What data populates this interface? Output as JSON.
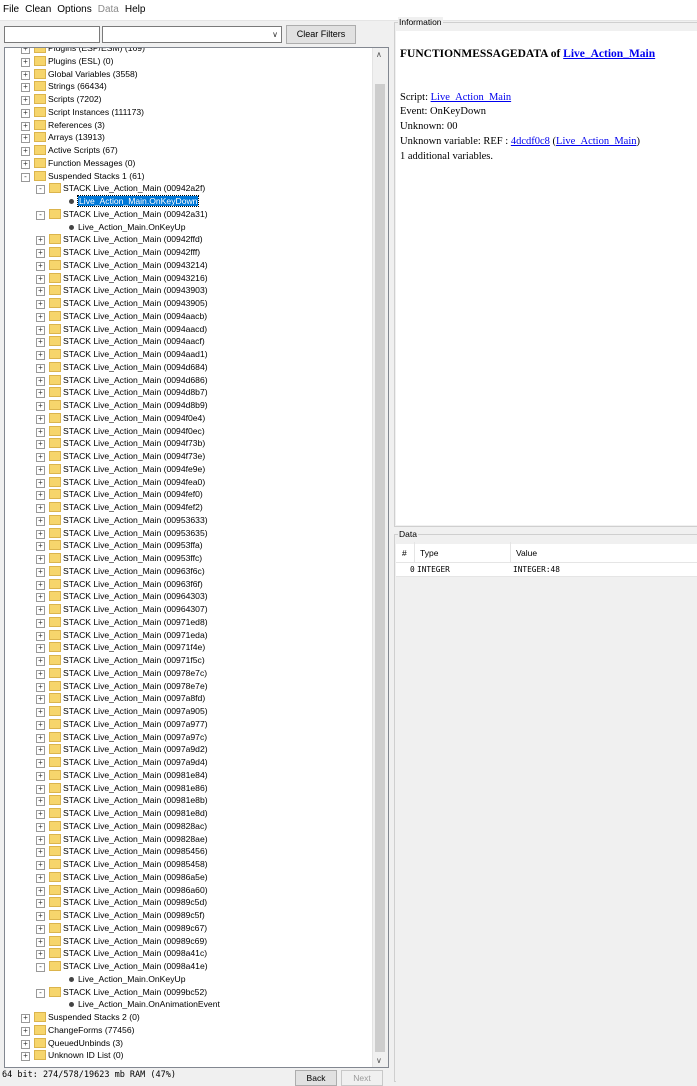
{
  "menu": {
    "file": "File",
    "clean": "Clean",
    "options": "Options",
    "data": "Data",
    "help": "Help"
  },
  "filters": {
    "text_value": "",
    "combo_value": "",
    "clear_button": "Clear Filters"
  },
  "tree": [
    {
      "level": 1,
      "expander": "+",
      "folder": true,
      "label": "Plugins (ESP/ESM) (169)"
    },
    {
      "level": 1,
      "expander": "+",
      "folder": true,
      "label": "Plugins (ESL) (0)"
    },
    {
      "level": 1,
      "expander": "+",
      "folder": true,
      "label": "Global Variables (3558)"
    },
    {
      "level": 1,
      "expander": "+",
      "folder": true,
      "label": "Strings (66434)"
    },
    {
      "level": 1,
      "expander": "+",
      "folder": true,
      "label": "Scripts (7202)"
    },
    {
      "level": 1,
      "expander": "+",
      "folder": true,
      "label": "Script Instances (111173)"
    },
    {
      "level": 1,
      "expander": "+",
      "folder": true,
      "label": "References (3)"
    },
    {
      "level": 1,
      "expander": "+",
      "folder": true,
      "label": "Arrays (13913)"
    },
    {
      "level": 1,
      "expander": "+",
      "folder": true,
      "label": "Active Scripts (67)"
    },
    {
      "level": 1,
      "expander": "+",
      "folder": true,
      "label": "Function Messages (0)"
    },
    {
      "level": 1,
      "expander": "-",
      "folder": true,
      "label": "Suspended Stacks 1 (61)"
    },
    {
      "level": 2,
      "expander": "-",
      "folder": true,
      "label": "STACK Live_Action_Main (00942a2f)"
    },
    {
      "level": 3,
      "expander": "",
      "folder": false,
      "label": "Live_Action_Main.OnKeyDown",
      "selected": true
    },
    {
      "level": 2,
      "expander": "-",
      "folder": true,
      "label": "STACK Live_Action_Main (00942a31)"
    },
    {
      "level": 3,
      "expander": "",
      "folder": false,
      "label": "Live_Action_Main.OnKeyUp"
    },
    {
      "level": 2,
      "expander": "+",
      "folder": true,
      "label": "STACK Live_Action_Main (00942ffd)"
    },
    {
      "level": 2,
      "expander": "+",
      "folder": true,
      "label": "STACK Live_Action_Main (00942fff)"
    },
    {
      "level": 2,
      "expander": "+",
      "folder": true,
      "label": "STACK Live_Action_Main (00943214)"
    },
    {
      "level": 2,
      "expander": "+",
      "folder": true,
      "label": "STACK Live_Action_Main (00943216)"
    },
    {
      "level": 2,
      "expander": "+",
      "folder": true,
      "label": "STACK Live_Action_Main (00943903)"
    },
    {
      "level": 2,
      "expander": "+",
      "folder": true,
      "label": "STACK Live_Action_Main (00943905)"
    },
    {
      "level": 2,
      "expander": "+",
      "folder": true,
      "label": "STACK Live_Action_Main (0094aacb)"
    },
    {
      "level": 2,
      "expander": "+",
      "folder": true,
      "label": "STACK Live_Action_Main (0094aacd)"
    },
    {
      "level": 2,
      "expander": "+",
      "folder": true,
      "label": "STACK Live_Action_Main (0094aacf)"
    },
    {
      "level": 2,
      "expander": "+",
      "folder": true,
      "label": "STACK Live_Action_Main (0094aad1)"
    },
    {
      "level": 2,
      "expander": "+",
      "folder": true,
      "label": "STACK Live_Action_Main (0094d684)"
    },
    {
      "level": 2,
      "expander": "+",
      "folder": true,
      "label": "STACK Live_Action_Main (0094d686)"
    },
    {
      "level": 2,
      "expander": "+",
      "folder": true,
      "label": "STACK Live_Action_Main (0094d8b7)"
    },
    {
      "level": 2,
      "expander": "+",
      "folder": true,
      "label": "STACK Live_Action_Main (0094d8b9)"
    },
    {
      "level": 2,
      "expander": "+",
      "folder": true,
      "label": "STACK Live_Action_Main (0094f0e4)"
    },
    {
      "level": 2,
      "expander": "+",
      "folder": true,
      "label": "STACK Live_Action_Main (0094f0ec)"
    },
    {
      "level": 2,
      "expander": "+",
      "folder": true,
      "label": "STACK Live_Action_Main (0094f73b)"
    },
    {
      "level": 2,
      "expander": "+",
      "folder": true,
      "label": "STACK Live_Action_Main (0094f73e)"
    },
    {
      "level": 2,
      "expander": "+",
      "folder": true,
      "label": "STACK Live_Action_Main (0094fe9e)"
    },
    {
      "level": 2,
      "expander": "+",
      "folder": true,
      "label": "STACK Live_Action_Main (0094fea0)"
    },
    {
      "level": 2,
      "expander": "+",
      "folder": true,
      "label": "STACK Live_Action_Main (0094fef0)"
    },
    {
      "level": 2,
      "expander": "+",
      "folder": true,
      "label": "STACK Live_Action_Main (0094fef2)"
    },
    {
      "level": 2,
      "expander": "+",
      "folder": true,
      "label": "STACK Live_Action_Main (00953633)"
    },
    {
      "level": 2,
      "expander": "+",
      "folder": true,
      "label": "STACK Live_Action_Main (00953635)"
    },
    {
      "level": 2,
      "expander": "+",
      "folder": true,
      "label": "STACK Live_Action_Main (00953ffa)"
    },
    {
      "level": 2,
      "expander": "+",
      "folder": true,
      "label": "STACK Live_Action_Main (00953ffc)"
    },
    {
      "level": 2,
      "expander": "+",
      "folder": true,
      "label": "STACK Live_Action_Main (00963f6c)"
    },
    {
      "level": 2,
      "expander": "+",
      "folder": true,
      "label": "STACK Live_Action_Main (00963f6f)"
    },
    {
      "level": 2,
      "expander": "+",
      "folder": true,
      "label": "STACK Live_Action_Main (00964303)"
    },
    {
      "level": 2,
      "expander": "+",
      "folder": true,
      "label": "STACK Live_Action_Main (00964307)"
    },
    {
      "level": 2,
      "expander": "+",
      "folder": true,
      "label": "STACK Live_Action_Main (00971ed8)"
    },
    {
      "level": 2,
      "expander": "+",
      "folder": true,
      "label": "STACK Live_Action_Main (00971eda)"
    },
    {
      "level": 2,
      "expander": "+",
      "folder": true,
      "label": "STACK Live_Action_Main (00971f4e)"
    },
    {
      "level": 2,
      "expander": "+",
      "folder": true,
      "label": "STACK Live_Action_Main (00971f5c)"
    },
    {
      "level": 2,
      "expander": "+",
      "folder": true,
      "label": "STACK Live_Action_Main (00978e7c)"
    },
    {
      "level": 2,
      "expander": "+",
      "folder": true,
      "label": "STACK Live_Action_Main (00978e7e)"
    },
    {
      "level": 2,
      "expander": "+",
      "folder": true,
      "label": "STACK Live_Action_Main (0097a8fd)"
    },
    {
      "level": 2,
      "expander": "+",
      "folder": true,
      "label": "STACK Live_Action_Main (0097a905)"
    },
    {
      "level": 2,
      "expander": "+",
      "folder": true,
      "label": "STACK Live_Action_Main (0097a977)"
    },
    {
      "level": 2,
      "expander": "+",
      "folder": true,
      "label": "STACK Live_Action_Main (0097a97c)"
    },
    {
      "level": 2,
      "expander": "+",
      "folder": true,
      "label": "STACK Live_Action_Main (0097a9d2)"
    },
    {
      "level": 2,
      "expander": "+",
      "folder": true,
      "label": "STACK Live_Action_Main (0097a9d4)"
    },
    {
      "level": 2,
      "expander": "+",
      "folder": true,
      "label": "STACK Live_Action_Main (00981e84)"
    },
    {
      "level": 2,
      "expander": "+",
      "folder": true,
      "label": "STACK Live_Action_Main (00981e86)"
    },
    {
      "level": 2,
      "expander": "+",
      "folder": true,
      "label": "STACK Live_Action_Main (00981e8b)"
    },
    {
      "level": 2,
      "expander": "+",
      "folder": true,
      "label": "STACK Live_Action_Main (00981e8d)"
    },
    {
      "level": 2,
      "expander": "+",
      "folder": true,
      "label": "STACK Live_Action_Main (009828ac)"
    },
    {
      "level": 2,
      "expander": "+",
      "folder": true,
      "label": "STACK Live_Action_Main (009828ae)"
    },
    {
      "level": 2,
      "expander": "+",
      "folder": true,
      "label": "STACK Live_Action_Main (00985456)"
    },
    {
      "level": 2,
      "expander": "+",
      "folder": true,
      "label": "STACK Live_Action_Main (00985458)"
    },
    {
      "level": 2,
      "expander": "+",
      "folder": true,
      "label": "STACK Live_Action_Main (00986a5e)"
    },
    {
      "level": 2,
      "expander": "+",
      "folder": true,
      "label": "STACK Live_Action_Main (00986a60)"
    },
    {
      "level": 2,
      "expander": "+",
      "folder": true,
      "label": "STACK Live_Action_Main (00989c5d)"
    },
    {
      "level": 2,
      "expander": "+",
      "folder": true,
      "label": "STACK Live_Action_Main (00989c5f)"
    },
    {
      "level": 2,
      "expander": "+",
      "folder": true,
      "label": "STACK Live_Action_Main (00989c67)"
    },
    {
      "level": 2,
      "expander": "+",
      "folder": true,
      "label": "STACK Live_Action_Main (00989c69)"
    },
    {
      "level": 2,
      "expander": "+",
      "folder": true,
      "label": "STACK Live_Action_Main (0098a41c)"
    },
    {
      "level": 2,
      "expander": "-",
      "folder": true,
      "label": "STACK Live_Action_Main (0098a41e)"
    },
    {
      "level": 3,
      "expander": "",
      "folder": false,
      "label": "Live_Action_Main.OnKeyUp"
    },
    {
      "level": 2,
      "expander": "-",
      "folder": true,
      "label": "STACK Live_Action_Main (0099bc52)"
    },
    {
      "level": 3,
      "expander": "",
      "folder": false,
      "label": "Live_Action_Main.OnAnimationEvent"
    },
    {
      "level": 1,
      "expander": "+",
      "folder": true,
      "label": "Suspended Stacks 2 (0)"
    },
    {
      "level": 1,
      "expander": "+",
      "folder": true,
      "label": "ChangeForms (77456)"
    },
    {
      "level": 1,
      "expander": "+",
      "folder": true,
      "label": "QueuedUnbinds (3)"
    },
    {
      "level": 1,
      "expander": "+",
      "folder": true,
      "label": "Unknown ID List (0)"
    }
  ],
  "info": {
    "group_label": "Information",
    "heading_prefix": "FUNCTIONMESSAGEDATA of ",
    "heading_link": "Live_Action_Main",
    "script_label": "Script: ",
    "script_link": "Live_Action_Main",
    "event": "Event: OnKeyDown",
    "unknown": "Unknown: 00",
    "unknown_var_prefix": "Unknown variable: REF : ",
    "unknown_var_link": "4dcdf0c8",
    "unknown_var_paren_open": " (",
    "unknown_var_paren_link": "Live_Action_Main",
    "unknown_var_paren_close": ")",
    "additional": "1 additional variables."
  },
  "data_panel": {
    "group_label": "Data",
    "columns": [
      "#",
      "Type",
      "Value"
    ],
    "rows": [
      {
        "index": "0",
        "type": "INTEGER",
        "value": "INTEGER:48"
      }
    ]
  },
  "status": {
    "text": "64 bit: 274/578/19623 mb RAM (47%)",
    "back_button": "Back",
    "next_button": "Next"
  }
}
